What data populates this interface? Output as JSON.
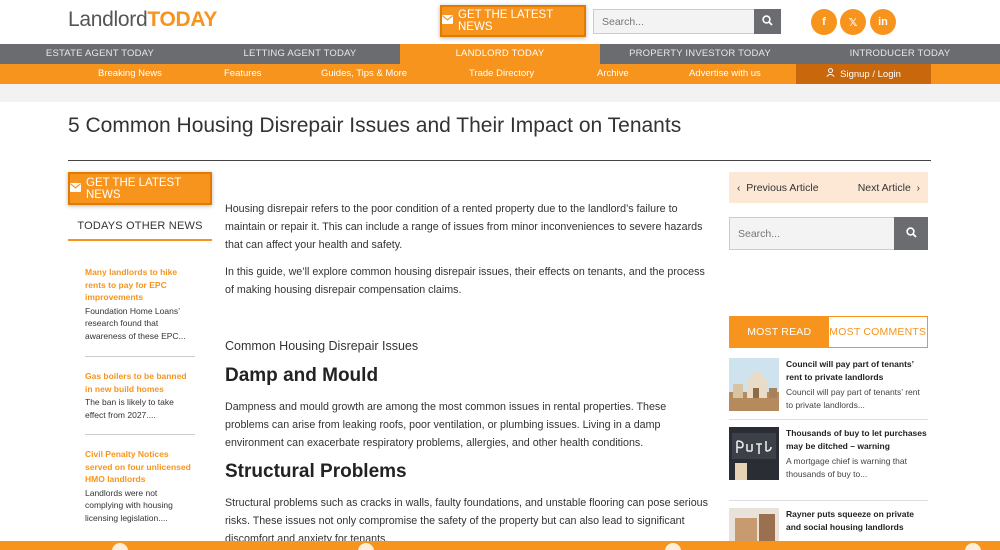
{
  "header": {
    "logo_part1": "Landlord",
    "logo_part2": "TODAY",
    "cta_label": "GET THE LATEST NEWS",
    "search_placeholder": "Search..."
  },
  "social": [
    {
      "name": "facebook-icon",
      "glyph": "f"
    },
    {
      "name": "x-twitter-icon",
      "glyph": "𝕏"
    },
    {
      "name": "linkedin-icon",
      "glyph": "in"
    }
  ],
  "nav_primary": [
    {
      "label": "ESTATE AGENT TODAY",
      "active": false
    },
    {
      "label": "LETTING AGENT TODAY",
      "active": false
    },
    {
      "label": "LANDLORD TODAY",
      "active": true
    },
    {
      "label": "PROPERTY INVESTOR TODAY",
      "active": false
    },
    {
      "label": "INTRODUCER TODAY",
      "active": false
    }
  ],
  "nav_secondary": [
    "Breaking News",
    "Features",
    "Guides, Tips & More",
    "Trade Directory",
    "Archive",
    "Advertise with us"
  ],
  "login_label": "Signup / Login",
  "article": {
    "title": "5 Common Housing Disrepair Issues and Their Impact on Tenants",
    "p1": "Housing disrepair refers to the poor condition of a rented property due to the landlord’s failure to maintain or repair it. This can include a range of issues from minor inconveniences to severe hazards that can affect your health and safety.",
    "p2": "In this guide, we’ll explore common housing disrepair issues, their effects on tenants, and the process of making housing disrepair compensation claims.",
    "subhead": "Common Housing Disrepair Issues",
    "h_damp": "Damp and Mould",
    "p_damp": "Dampness and mould growth are among the most common issues in rental properties. These problems can arise from leaking roofs, poor ventilation, or plumbing issues. Living in a damp environment can exacerbate respiratory problems, allergies, and other health conditions.",
    "h_struct": "Structural Problems",
    "p_struct": "Structural problems such as cracks in walls, faulty foundations, and unstable flooring can pose serious risks. These issues not only compromise the safety of the property but can also lead to significant discomfort and anxiety for tenants."
  },
  "left_sidebar": {
    "cta_label": "GET THE LATEST NEWS",
    "heading": "TODAYS OTHER NEWS",
    "items": [
      {
        "title": "Many landlords to hike rents to pay for EPC improvements",
        "summary": "Foundation Home Loans’ research found that awareness of these EPC..."
      },
      {
        "title": "Gas boilers to be banned in new build homes",
        "summary": "The ban is likely to take effect from 2027...."
      },
      {
        "title": "Civil Penalty Notices served on four unlicensed HMO landlords",
        "summary": "Landlords were not complying with housing licensing legislation...."
      }
    ]
  },
  "right_sidebar": {
    "prev_label": "Previous Article",
    "next_label": "Next Article",
    "search_placeholder": "Search...",
    "tab_most_read": "MOST READ",
    "tab_most_comments": "MOST COMMENTS",
    "items": [
      {
        "title": "Council will pay part of tenants’ rent to private landlords",
        "summary": "Council will pay part of tenants’ rent to private landlords..."
      },
      {
        "title": "Thousands of buy to let purchases may be ditched – warning",
        "summary": "A mortgage chief is warning that thousands of buy to..."
      },
      {
        "title": "Rayner puts squeeze on private and social housing landlords",
        "summary": ""
      }
    ]
  },
  "colors": {
    "accent": "#f7941d",
    "nav_grey": "#6b6c70",
    "login_bg": "#c8670c"
  }
}
